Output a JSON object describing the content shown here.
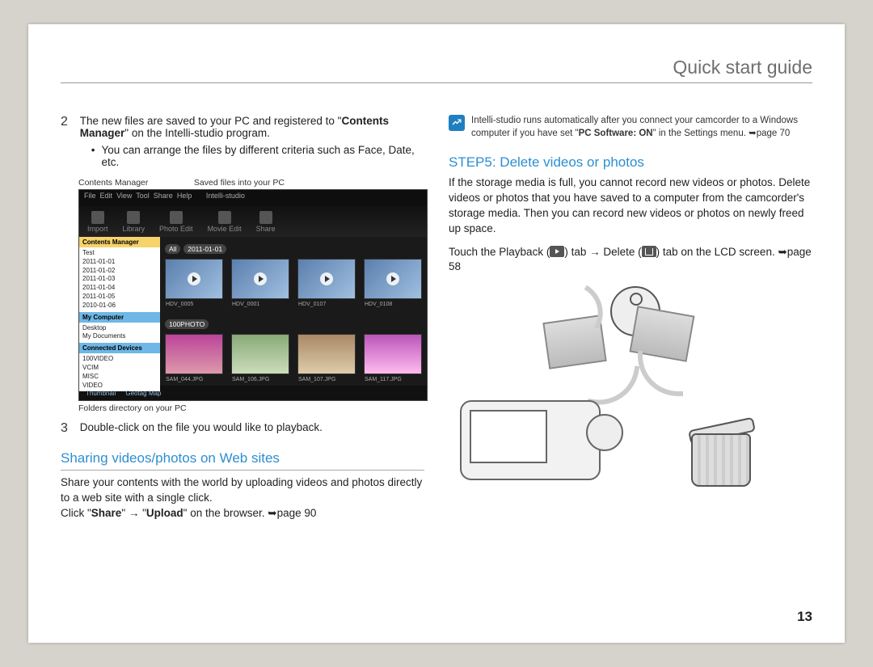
{
  "header": {
    "title": "Quick start guide"
  },
  "page_number": "13",
  "step2": {
    "num": "2",
    "text_pre": "The new files are saved to your PC and registered to \"",
    "bold1": "Contents Manager",
    "text_mid": "\" on the Intelli-studio program.",
    "bullet": "You can arrange the files by different criteria such as Face, Date, etc."
  },
  "captions": {
    "contents_manager": "Contents Manager",
    "saved_files": "Saved files into your PC",
    "folders": "Folders directory on your PC"
  },
  "screenshot": {
    "titlebar": "Intelli-studio",
    "menus": [
      "File",
      "Edit",
      "View",
      "Tool",
      "Share",
      "Help"
    ],
    "toolbar": [
      "Import",
      "Library",
      "Photo Edit",
      "Movie Edit",
      "Share"
    ],
    "panel_contents": "Contents Manager",
    "tree_root": "Test",
    "tree_dates": [
      "2011-01-01",
      "2011-01-02",
      "2011-01-03",
      "2011-01-04",
      "2011-01-05",
      "2010-01-06"
    ],
    "panel_mypc": "My Computer",
    "tree_pc": [
      "Desktop",
      "My Documents"
    ],
    "panel_devices": "Connected Devices",
    "tree_dev": [
      "100VIDEO",
      "VCIM",
      "MISC",
      "VIDEO"
    ],
    "crumbs": [
      "All",
      "2011-01-01"
    ],
    "album": "100PHOTO",
    "vid_names": [
      "HDV_0005",
      "HDV_0001",
      "HDV_0107",
      "HDV_0108"
    ],
    "img_names": [
      "SAM_044.JPG",
      "SAM_106.JPG",
      "SAM_107.JPG",
      "SAM_117.JPG"
    ],
    "foot": [
      "Thumbnail",
      "Geotag Map"
    ]
  },
  "step3": {
    "num": "3",
    "text": "Double-click on the file you would like to playback."
  },
  "sharing": {
    "heading": "Sharing videos/photos on Web sites",
    "p1": "Share your contents with the world by uploading videos and photos directly to a web site with a single click.",
    "click": "Click \"",
    "share": "Share",
    "arrow": "\" → \"",
    "upload": "Upload",
    "after": "\" on the browser. ➥page 90"
  },
  "note": {
    "pre": "Intelli-studio runs automatically after you connect your camcorder to a Windows computer if you have set \"",
    "bold": "PC Software: ON",
    "post": "\" in the Settings menu. ➥page 70"
  },
  "step5": {
    "heading": "STEP5: Delete videos or photos",
    "p1": "If the storage media is full, you cannot record new videos or photos. Delete videos or photos that you have saved to a computer from the camcorder's storage media. Then you can record new videos or photos on newly freed up space.",
    "touch_pre": "Touch the Playback (",
    "touch_mid": ") tab → Delete (",
    "touch_post": ") tab on the LCD screen. ➥page 58"
  }
}
